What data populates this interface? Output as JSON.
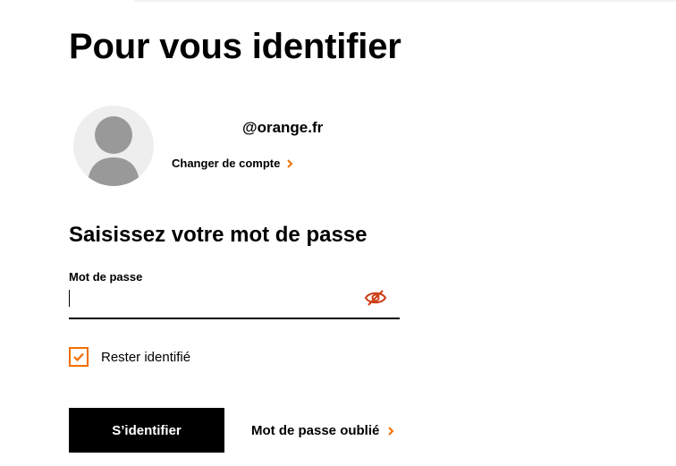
{
  "header": {
    "title": "Pour vous identifier"
  },
  "account": {
    "email": "@orange.fr",
    "change_label": "Changer de compte",
    "avatar_icon": "user-avatar-icon"
  },
  "password_section": {
    "title": "Saisissez votre mot de passe",
    "field_label": "Mot de passe",
    "value": "",
    "toggle_icon": "eye-slash-icon"
  },
  "remember": {
    "label": "Rester identifié",
    "checked": true
  },
  "actions": {
    "submit_label": "S’identifier",
    "forgot_label": "Mot de passe oublié"
  },
  "colors": {
    "accent": "#f16e00",
    "toggle_icon": "#cd3c14",
    "button_bg": "#000000",
    "avatar_bg": "#eeeeee",
    "avatar_fg": "#999999"
  }
}
